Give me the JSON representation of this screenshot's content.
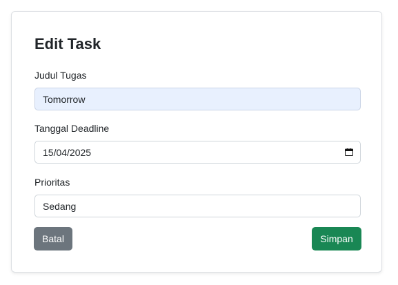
{
  "form": {
    "title": "Edit Task",
    "fields": [
      {
        "label": "Judul Tugas",
        "value": "Tomorrow"
      },
      {
        "label": "Tanggal Deadline",
        "value": "15/04/2025"
      },
      {
        "label": "Prioritas",
        "value": "Sedang"
      }
    ],
    "cancel_label": "Batal",
    "save_label": "Simpan"
  },
  "colors": {
    "save_button": "#198754",
    "cancel_button": "#6c757d",
    "autofill_bg": "#e8f0fe"
  },
  "icons": {
    "date_picker": "calendar-icon"
  }
}
